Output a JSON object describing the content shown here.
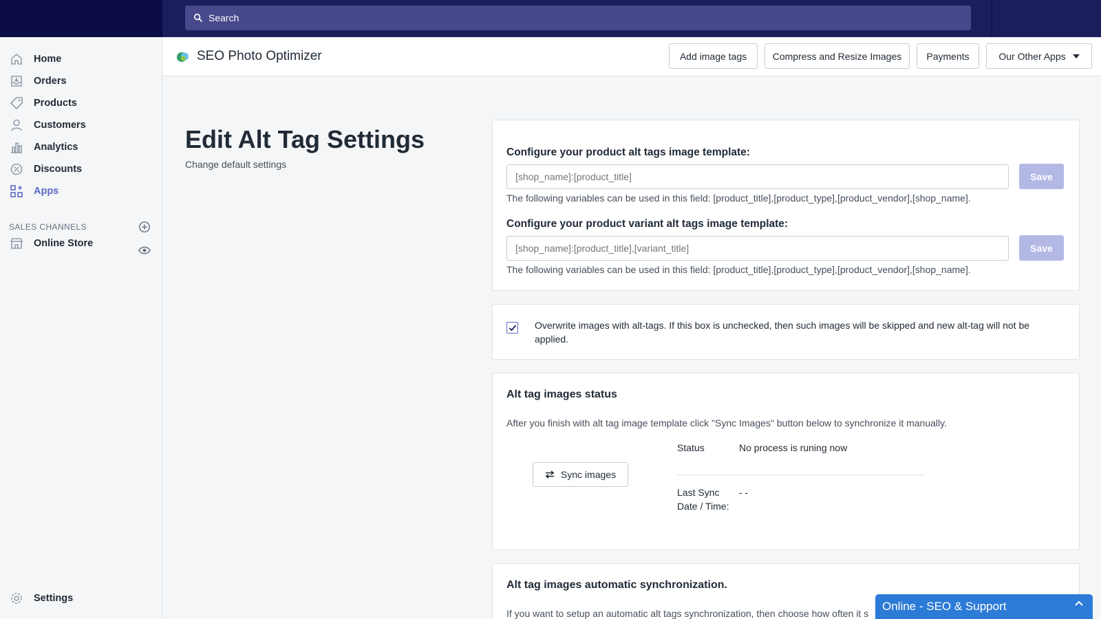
{
  "topbar": {
    "search_placeholder": "Search"
  },
  "sidebar": {
    "items": [
      {
        "label": "Home",
        "icon": "home-icon"
      },
      {
        "label": "Orders",
        "icon": "orders-icon"
      },
      {
        "label": "Products",
        "icon": "tag-icon"
      },
      {
        "label": "Customers",
        "icon": "person-icon"
      },
      {
        "label": "Analytics",
        "icon": "bar-chart-icon"
      },
      {
        "label": "Discounts",
        "icon": "discount-icon"
      },
      {
        "label": "Apps",
        "icon": "apps-icon",
        "active": true
      }
    ],
    "channels_label": "SALES CHANNELS",
    "channels": [
      {
        "label": "Online Store",
        "icon": "store-icon"
      }
    ],
    "settings_label": "Settings"
  },
  "appbar": {
    "title": "SEO Photo Optimizer",
    "buttons": {
      "add_tags": "Add image tags",
      "compress": "Compress and Resize Images",
      "payments": "Payments",
      "other_apps": "Our Other Apps"
    }
  },
  "page": {
    "title": "Edit Alt Tag Settings",
    "subtitle": "Change default settings"
  },
  "templates": {
    "product_label": "Configure your product alt tags image template:",
    "product_placeholder": "[shop_name]:[product_title]",
    "variant_label": "Configure your product variant alt tags image template:",
    "variant_placeholder": "[shop_name]:[product_title],[variant_title]",
    "help": "The following variables can be used in this field: [product_title],[product_type],[product_vendor],[shop_name].",
    "save_label": "Save"
  },
  "overwrite": {
    "checked": true,
    "text": "Overwrite images with alt-tags. If this box is unchecked, then such images will be skipped and new alt-tag will not be applied."
  },
  "status_card": {
    "title": "Alt tag images status",
    "description": "After you finish with alt tag image template click \"Sync Images\" button below to synchronize it manually.",
    "sync_button": "Sync images",
    "status_label": "Status",
    "status_value": "No process is runing now",
    "last_sync_label": "Last Sync Date / Time:",
    "last_sync_value": "- -"
  },
  "auto_card": {
    "title": "Alt tag images automatic synchronization.",
    "description": "If you want to setup an automatic alt tags synchronization, then choose how often it s"
  },
  "chat": {
    "label": "Online - SEO & Support"
  },
  "colors": {
    "accent": "#5c6ac4",
    "topbar": "#1c1e5c",
    "chat": "#2c7bd6"
  }
}
